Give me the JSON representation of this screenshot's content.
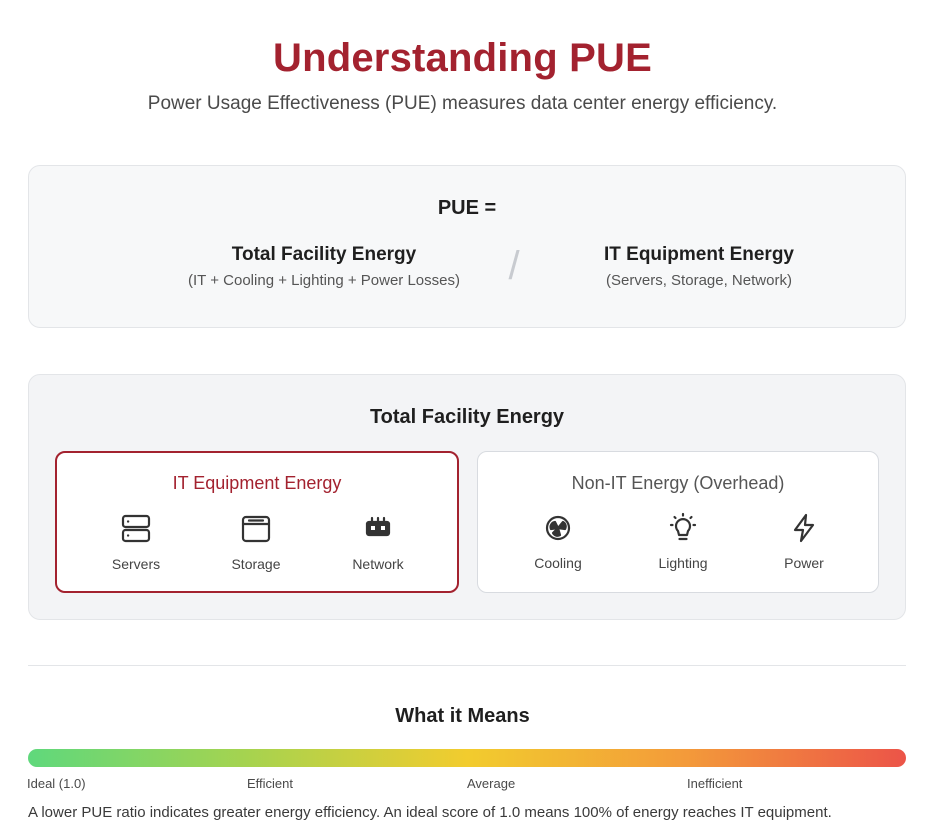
{
  "header": {
    "title": "Understanding PUE",
    "subtitle": "Power Usage Effectiveness (PUE) measures data center energy efficiency."
  },
  "formula": {
    "label": "PUE =",
    "numerator": {
      "name": "Total Facility Energy",
      "note": "(IT + Cooling + Lighting + Power Losses)"
    },
    "divider": "/",
    "denominator": {
      "name": "IT Equipment Energy",
      "note": "(Servers, Storage, Network)"
    }
  },
  "breakdown": {
    "title": "Total Facility Energy",
    "it": {
      "title": "IT Equipment Energy",
      "items": [
        {
          "label": "Servers",
          "icon": "server-icon"
        },
        {
          "label": "Storage",
          "icon": "storage-icon"
        },
        {
          "label": "Network",
          "icon": "network-icon"
        }
      ]
    },
    "non_it": {
      "title": "Non-IT Energy (Overhead)",
      "items": [
        {
          "label": "Cooling",
          "icon": "fan-icon"
        },
        {
          "label": "Lighting",
          "icon": "lightbulb-icon"
        },
        {
          "label": "Power",
          "icon": "lightning-icon"
        }
      ]
    }
  },
  "meaning": {
    "title": "What it Means",
    "scale_labels": [
      "Ideal (1.0)",
      "Efficient",
      "Average",
      "Inefficient"
    ],
    "note": "A lower PUE ratio indicates greater energy efficiency. An ideal score of 1.0 means 100% of energy reaches IT equipment."
  },
  "colors": {
    "accent": "#a3222f",
    "scale_start": "#5fd87c",
    "scale_mid": "#f2cc2e",
    "scale_end": "#ec5448"
  }
}
